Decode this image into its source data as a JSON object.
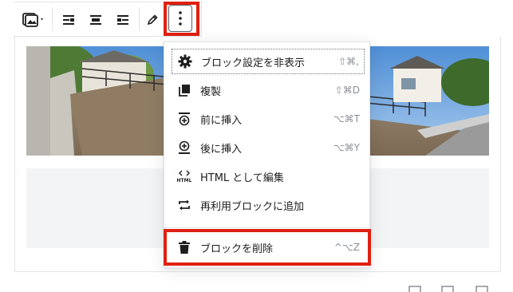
{
  "toolbar": {
    "buttons": [
      {
        "name": "change-image-type",
        "icon": "image-icon"
      },
      {
        "name": "align-left",
        "icon": "align-left-icon"
      },
      {
        "name": "align-center",
        "icon": "align-center-icon"
      },
      {
        "name": "align-right",
        "icon": "align-right-icon"
      },
      {
        "name": "edit",
        "icon": "pencil-icon"
      },
      {
        "name": "more-options",
        "icon": "more-vertical-icon"
      }
    ],
    "highlight_color": "#e0200f"
  },
  "menu": {
    "items": [
      {
        "label": "ブロック設定を非表示",
        "shortcut": "⇧⌘,",
        "icon": "gear-icon"
      },
      {
        "label": "複製",
        "shortcut": "⇧⌘D",
        "icon": "duplicate-icon"
      },
      {
        "label": "前に挿入",
        "shortcut": "⌥⌘T",
        "icon": "insert-before-icon"
      },
      {
        "label": "後に挿入",
        "shortcut": "⌥⌘Y",
        "icon": "insert-after-icon"
      },
      {
        "label": "HTML として編集",
        "shortcut": "",
        "icon": "html-icon"
      },
      {
        "label": "再利用ブロックに追加",
        "shortcut": "",
        "icon": "reusable-block-icon"
      },
      {
        "label": "ブロックを削除",
        "shortcut": "^⌥Z",
        "icon": "trash-icon"
      }
    ]
  },
  "colors": {
    "accent_highlight": "#e0200f",
    "border": "#e2e4e7",
    "caption_bg": "#f3f4f5"
  }
}
